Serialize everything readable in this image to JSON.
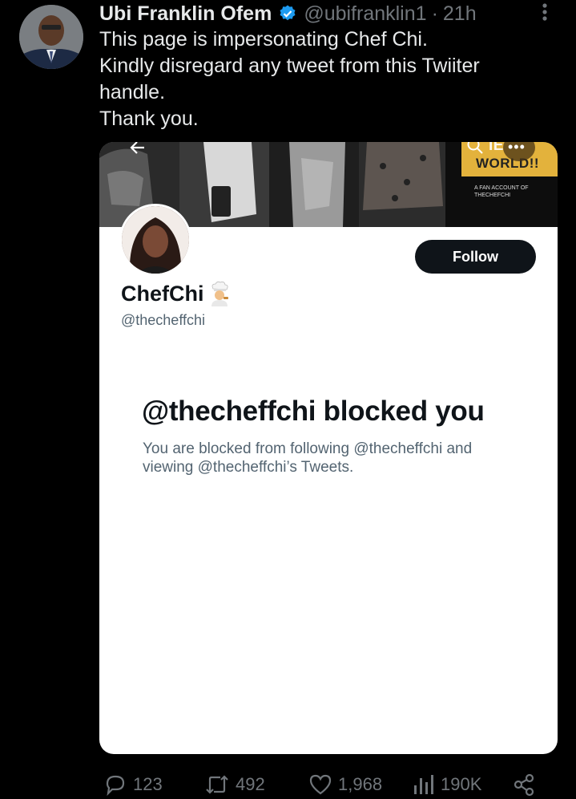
{
  "tweet": {
    "author_name": "Ubi Franklin Ofem",
    "handle": "@ubifranklin1",
    "separator": "·",
    "time": "21h",
    "lines": [
      "This page is impersonating Chef Chi.",
      "Kindly disregard any tweet from this Twiiter",
      "handle.",
      "Thank you."
    ]
  },
  "embedded_profile": {
    "banner_text": "WORLD!!",
    "banner_text_partial": "IE",
    "banner_sub": "A FAN ACCOUNT OF THECHEFCHI",
    "follow_label": "Follow",
    "name": "ChefChi",
    "handle": "@thecheffchi",
    "blocked_title": "@thecheffchi blocked you",
    "blocked_desc": "You are blocked from following @thecheffchi and viewing @thecheffchi’s Tweets."
  },
  "actions": {
    "replies": "123",
    "retweets": "492",
    "likes": "1,968",
    "views": "190K"
  },
  "icons": {
    "verified": "verified-badge-icon",
    "more": "more-vertical-icon",
    "reply": "reply-icon",
    "retweet": "retweet-icon",
    "like": "heart-icon",
    "views": "views-chart-icon",
    "share": "share-icon"
  },
  "colors": {
    "background": "#000000",
    "verified": "#1d9bf0",
    "muted": "#71767b",
    "banner_accent": "#e3b23c"
  }
}
